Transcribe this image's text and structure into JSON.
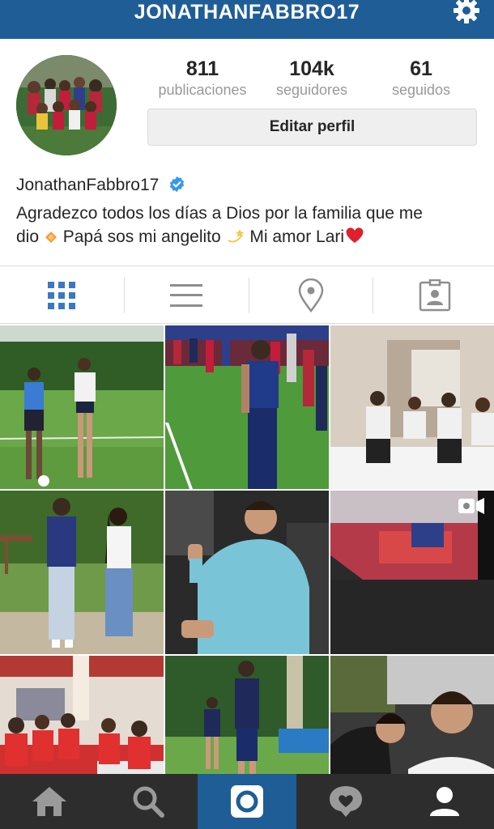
{
  "header": {
    "title": "JONATHANFABBRO17",
    "settings_icon": "gear-icon"
  },
  "profile": {
    "stats": [
      {
        "value": "811",
        "label": "publicaciones"
      },
      {
        "value": "104k",
        "label": "seguidores"
      },
      {
        "value": "61",
        "label": "seguidos"
      }
    ],
    "edit_label": "Editar perfil",
    "name": "JonathanFabbro17",
    "verified_icon": "verified-badge-icon",
    "bio": {
      "line1": "Agradezco todos los días a Dios por la familia que me",
      "part_a": "dio",
      "part_b": "Papá sos mi angelito",
      "part_c": "Mi amor Lari"
    }
  },
  "tabs": [
    {
      "icon": "grid-icon",
      "active": true
    },
    {
      "icon": "list-icon",
      "active": false
    },
    {
      "icon": "location-pin-icon",
      "active": false
    },
    {
      "icon": "tagged-photos-icon",
      "active": false
    }
  ],
  "grid": {
    "video_badge_icon": "video-camera-icon"
  },
  "bottom_nav": [
    {
      "icon": "home-icon"
    },
    {
      "icon": "search-icon"
    },
    {
      "icon": "camera-icon",
      "active": true
    },
    {
      "icon": "activity-heart-icon"
    },
    {
      "icon": "profile-icon"
    }
  ],
  "colors": {
    "brand_blue": "#1f5d96",
    "tab_active": "#3a78c2",
    "nav_background": "#2d2d2d",
    "verified": "#3897f0"
  }
}
